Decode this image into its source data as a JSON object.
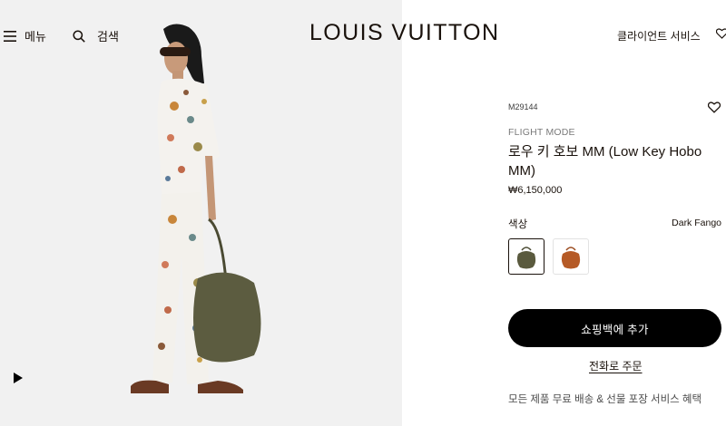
{
  "header": {
    "menu_label": "메뉴",
    "menu_icon": "hamburger-icon",
    "search_label": "검색",
    "search_icon": "search-icon",
    "logo": "LOUIS VUITTON",
    "client_services": "클라이언트 서비스",
    "wishlist_icon": "heart-icon"
  },
  "media": {
    "play_icon": "play-icon"
  },
  "product": {
    "sku": "M29144",
    "collection": "FLIGHT MODE",
    "title": "로우 키 호보 MM (Low Key Hobo MM)",
    "price": "₩6,150,000",
    "wishlist_icon": "heart-icon",
    "color_label": "색상",
    "color_selected": "Dark Fango",
    "swatches": [
      {
        "color": "#5a5a3e",
        "selected": true
      },
      {
        "color": "#b55a26",
        "selected": false
      }
    ],
    "add_to_bag": "쇼핑백에 추가",
    "phone_order": "전화로 주문",
    "benefits": "모든 제품 무료 배송 & 선물 포장 서비스 혜택"
  },
  "colors": {
    "text": "#19110b",
    "button_bg": "#000000",
    "image_bg": "#f1f1f1"
  }
}
